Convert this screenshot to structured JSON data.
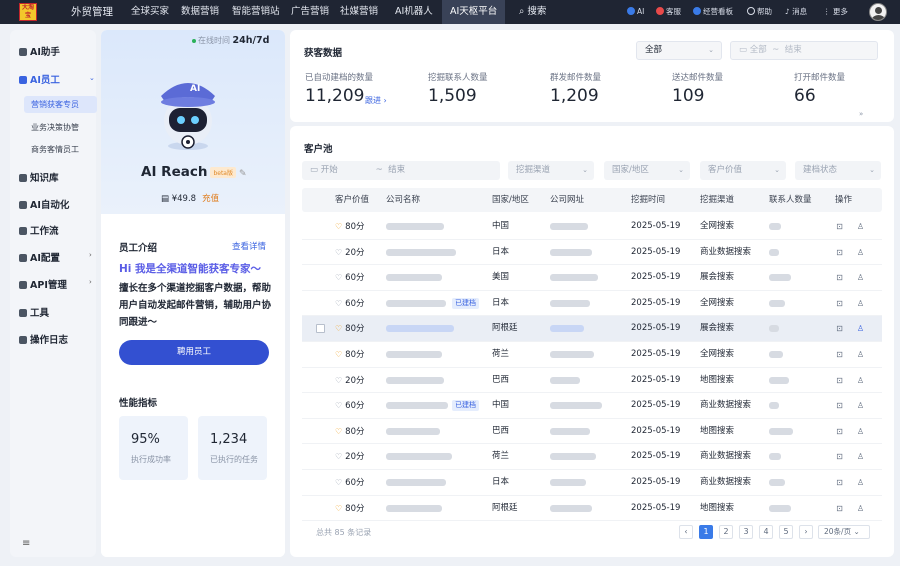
{
  "topbar": {
    "logo_text": "大淘宝",
    "nav": [
      "外贸管理",
      "全球买家",
      "数据营销",
      "智能营销站",
      "广告营销",
      "社媒营销",
      "AI机器人",
      "AI天枢平台"
    ],
    "active_nav": "AI天枢平台",
    "search_label": "搜索",
    "tools": [
      "AI",
      "客服",
      "经营看板",
      "帮助",
      "消息",
      "更多"
    ]
  },
  "sidebar": {
    "items": [
      "AI助手",
      "AI员工",
      "知识库",
      "AI自动化",
      "工作流",
      "AI配置",
      "API管理",
      "工具",
      "操作日志"
    ],
    "sub_items": [
      "营销获客专员",
      "业务决策协管",
      "商务客情员工"
    ],
    "active_item": "AI员工",
    "active_sub": "营销获客专员",
    "collapse_icon": "≡"
  },
  "profile": {
    "online_label": "在线时间",
    "online_value": "24h/7d",
    "robot_badge": "AI",
    "name": "AI Reach",
    "beta": "beta版",
    "price": "¥49.8",
    "recharge": "充值",
    "intro_title": "员工介绍",
    "intro_link": "查看详情",
    "intro_headline": "Hi 我是全渠道智能获客专家～",
    "intro_text": "擅长在多个渠道挖掘客户数据，帮助用户自动发起邮件营销，辅助用户协同跟进～",
    "hire_button": "聘用员工",
    "perf_title": "性能指标",
    "kpis": [
      {
        "value": "95%",
        "label": "执行成功率"
      },
      {
        "value": "1,234",
        "label": "已执行的任务"
      }
    ]
  },
  "acquire": {
    "title": "获客数据",
    "filter_all": "全部",
    "date_start": "全部",
    "date_end": "结束",
    "stats": [
      {
        "label": "已自动建档的数量",
        "value": "11,209",
        "link": "跟进 ›"
      },
      {
        "label": "挖掘联系人数量",
        "value": "1,509"
      },
      {
        "label": "群发邮件数量",
        "value": "1,209"
      },
      {
        "label": "送达邮件数量",
        "value": "109"
      },
      {
        "label": "打开邮件数量",
        "value": "66"
      }
    ],
    "expand_icon": "»"
  },
  "pool": {
    "title": "客户池",
    "filters": {
      "start": "开始",
      "end": "结束",
      "channel": "挖掘渠道",
      "region": "国家/地区",
      "value": "客户价值",
      "status": "建档状态"
    },
    "columns": [
      "客户价值",
      "公司名称",
      "国家/地区",
      "公司网址",
      "挖掘时间",
      "挖掘渠道",
      "联系人数量",
      "操作"
    ],
    "rows": [
      {
        "score": "80分",
        "hot": true,
        "country": "中国",
        "date": "2025-05-19",
        "channel": "全网搜索",
        "tag": ""
      },
      {
        "score": "20分",
        "hot": false,
        "country": "日本",
        "date": "2025-05-19",
        "channel": "商业数据搜索",
        "tag": ""
      },
      {
        "score": "60分",
        "hot": false,
        "country": "美国",
        "date": "2025-05-19",
        "channel": "展会搜索",
        "tag": ""
      },
      {
        "score": "60分",
        "hot": false,
        "country": "日本",
        "date": "2025-05-19",
        "channel": "全网搜索",
        "tag": "已建档"
      },
      {
        "score": "80分",
        "hot": true,
        "country": "阿根廷",
        "date": "2025-05-19",
        "channel": "展会搜索",
        "tag": ""
      },
      {
        "score": "80分",
        "hot": true,
        "country": "荷兰",
        "date": "2025-05-19",
        "channel": "全网搜索",
        "tag": ""
      },
      {
        "score": "20分",
        "hot": false,
        "country": "巴西",
        "date": "2025-05-19",
        "channel": "地图搜索",
        "tag": ""
      },
      {
        "score": "60分",
        "hot": false,
        "country": "中国",
        "date": "2025-05-19",
        "channel": "商业数据搜索",
        "tag": "已建档"
      },
      {
        "score": "80分",
        "hot": true,
        "country": "巴西",
        "date": "2025-05-19",
        "channel": "地图搜索",
        "tag": ""
      },
      {
        "score": "20分",
        "hot": false,
        "country": "荷兰",
        "date": "2025-05-19",
        "channel": "商业数据搜索",
        "tag": ""
      },
      {
        "score": "60分",
        "hot": false,
        "country": "日本",
        "date": "2025-05-19",
        "channel": "商业数据搜索",
        "tag": ""
      },
      {
        "score": "80分",
        "hot": true,
        "country": "阿根廷",
        "date": "2025-05-19",
        "channel": "地图搜索",
        "tag": ""
      }
    ],
    "total": "总共 85 条记录",
    "pages": [
      "1",
      "2",
      "3",
      "4",
      "5"
    ],
    "current_page": "1",
    "page_size": "20条/页"
  },
  "colors": {
    "accent": "#3a63e0",
    "topbar": "#1f2533",
    "heart_hot": "#f0a020"
  }
}
